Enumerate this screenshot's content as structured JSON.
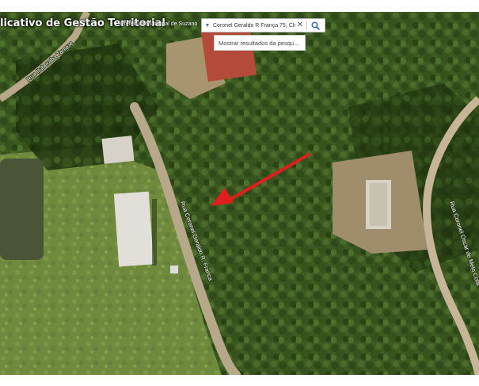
{
  "app": {
    "title": "licativo de Gestão Territorial",
    "subtitle": "Prefeitura Municipal de Suzano"
  },
  "search": {
    "value": "Coronel Geraldo R França 75, Cli...",
    "suggestion": "Mostrar resultados da pesqu..."
  },
  "map": {
    "road_labels": [
      "Rua Coronel Geraldo R. França",
      "Rua Coronel Oscar de Melo Cota",
      "Rua Ituberaba Tanque"
    ],
    "marker_color": "#e01e1e"
  },
  "icons": [
    "dropdown-caret-icon",
    "clear-icon",
    "search-icon",
    "arrow-marker-icon"
  ]
}
